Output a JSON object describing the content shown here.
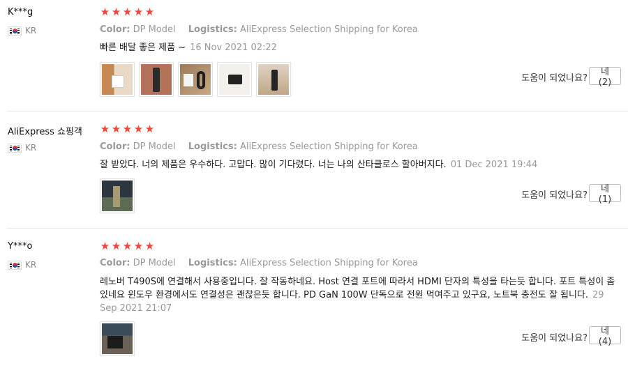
{
  "labels": {
    "color_key": "Color:",
    "logistics_key": "Logistics:",
    "helpful_question": "도움이 되었나요?"
  },
  "colors": {
    "star": "#f0463b",
    "muted": "#999999"
  },
  "reviews": [
    {
      "user": "K***g",
      "country": "KR",
      "rating": 5,
      "color": "DP Model",
      "logistics": "AliExpress Selection Shipping for Korea",
      "text": "빠른 배달 좋은 제품 ~",
      "date": "16 Nov 2021 02:22",
      "photos": [
        "photo-charger-box",
        "photo-charger-black",
        "photo-charger-parts",
        "photo-charger-plug",
        "photo-charger-cable"
      ],
      "helpful_button": "네 (2)"
    },
    {
      "user": "AliExpress 쇼핑객",
      "country": "KR",
      "rating": 5,
      "color": "DP Model",
      "logistics": "AliExpress Selection Shipping for Korea",
      "text": "잘 받았다. 너의 제품은 우수하다. 고맙다. 많이 기다렸다. 너는 나의 산타클로스 할아버지다.",
      "date": "01 Dec 2021 19:44",
      "photos": [
        "photo-device-in-use"
      ],
      "helpful_button": "네 (1)"
    },
    {
      "user": "Y***o",
      "country": "KR",
      "rating": 5,
      "color": "DP Model",
      "logistics": "AliExpress Selection Shipping for Korea",
      "text": "레노버 T490S에 연결해서 사용중입니다. 잘 작동하네요. Host 연결 포트에 따라서 HDMI 단자의 특성을 타는듯 합니다. 포트 특성이 좀 있네요 윈도우 환경에서도 연결성은 괜찮은듯 합니다. PD GaN 100W 단독으로 전원 먹여주고 있구요, 노트북 충전도 잘 됩니다.",
      "date": "29 Sep 2021 21:07",
      "photos": [
        "photo-laptop-setup"
      ],
      "helpful_button": "네 (4)"
    }
  ]
}
